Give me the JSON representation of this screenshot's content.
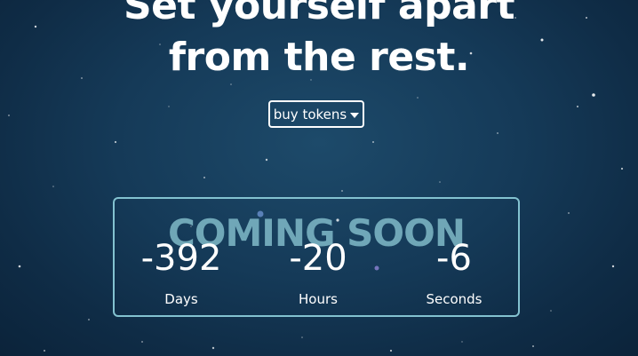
{
  "hero": {
    "headline_line1": "Set yourself apart",
    "headline_line2": "from the rest.",
    "cta_label": "buy tokens",
    "cta_icon": "caret-down-icon"
  },
  "countdown": {
    "banner": "COMING SOON",
    "units": [
      {
        "value": "-392",
        "label": "Days"
      },
      {
        "value": "-20",
        "label": "Hours"
      },
      {
        "value": "-6",
        "label": "Seconds"
      }
    ]
  },
  "colors": {
    "background": "#153a58",
    "panel_border": "#83c2d0",
    "banner_text": "#7ab3c2"
  }
}
